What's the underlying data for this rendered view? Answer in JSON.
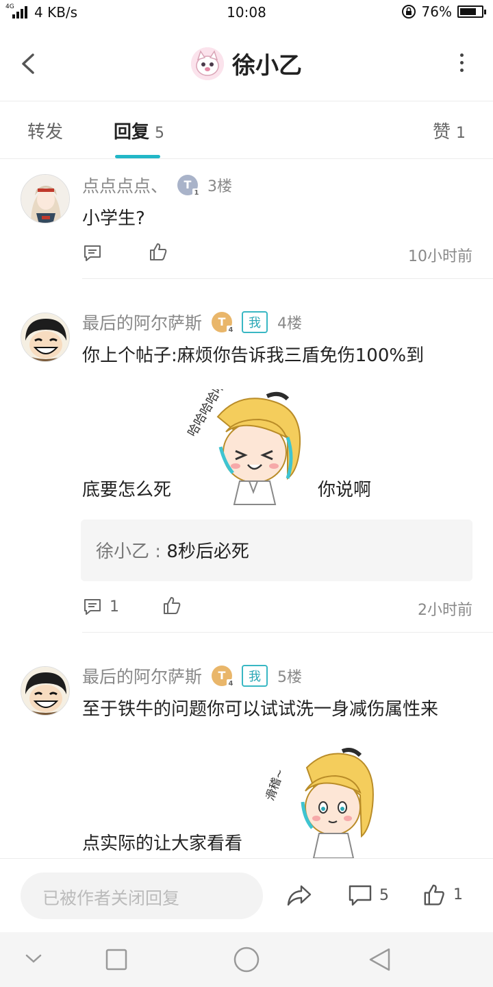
{
  "status_bar": {
    "network_type": "4G",
    "speed": "4 KB/s",
    "time": "10:08",
    "battery": "76%",
    "battery_level": 0.76
  },
  "header": {
    "title": "徐小乙"
  },
  "tabs": {
    "forward": {
      "label": "转发"
    },
    "reply": {
      "label": "回复",
      "count": "5"
    },
    "like": {
      "label": "赞",
      "count": "1"
    }
  },
  "posts": [
    {
      "user": "点点点点、",
      "level": "T",
      "level_sub": "1",
      "floor": "3楼",
      "text": "小学生?",
      "time": "10小时前",
      "comments": "",
      "likes": ""
    },
    {
      "user": "最后的阿尔萨斯",
      "level": "T",
      "level_sub": "4",
      "tag": "我",
      "floor": "4楼",
      "text_line1": "你上个帖子:麻烦你告诉我三盾免伤100%到",
      "text_line2a": "底要怎么死",
      "text_line2b": "你说啊",
      "sticker_text": "哈哈哈哈哈...",
      "quote_author": "徐小乙",
      "quote_sep": " : ",
      "quote_text": "8秒后必死",
      "comments": "1",
      "time": "2小时前"
    },
    {
      "user": "最后的阿尔萨斯",
      "level": "T",
      "level_sub": "4",
      "tag": "我",
      "floor": "5楼",
      "text_line1": "至于铁牛的问题你可以试试洗一身减伤属性来",
      "text_line2": "点实际的让大家看看",
      "sticker_text": "滑稽~"
    }
  ],
  "bottom_bar": {
    "placeholder": "已被作者关闭回复",
    "comments": "5",
    "likes": "1"
  },
  "colors": {
    "accent": "#22b7c7",
    "text": "#222222",
    "muted": "#888888",
    "gold_badge": "#e9b66a",
    "silver_badge": "#a9b3c9"
  }
}
